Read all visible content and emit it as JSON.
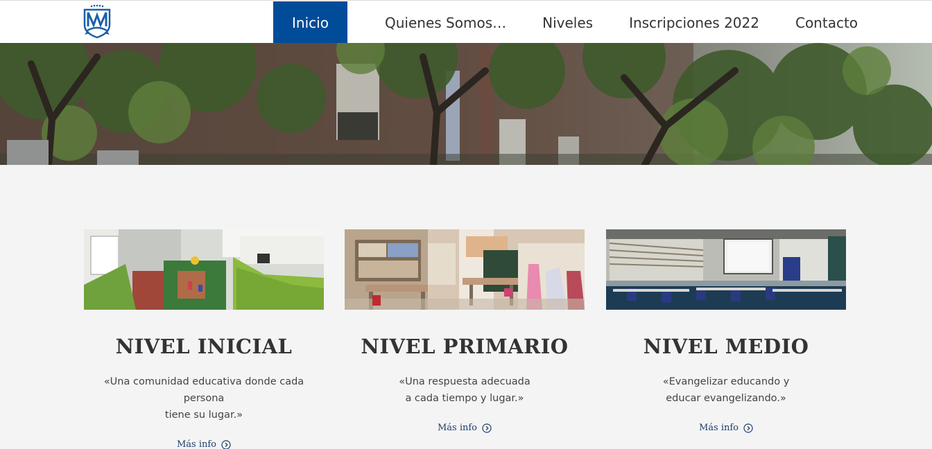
{
  "header": {
    "logo_icon": "school-crest-logo",
    "nav": [
      {
        "label": "Inicio",
        "active": true
      },
      {
        "label": "Quienes Somos…",
        "active": false
      },
      {
        "label": "Niveles",
        "active": false
      },
      {
        "label": "Inscripciones 2022",
        "active": false
      },
      {
        "label": "Contacto",
        "active": false
      }
    ]
  },
  "hero": {
    "image": "school-building-with-trees-photo"
  },
  "cards": [
    {
      "image": "playground-photo",
      "title": "NIVEL INICIAL",
      "description": "«Una comunidad educativa donde cada persona\ntiene su lugar.»",
      "link": "Más info",
      "link_icon": "circle-chevron-right-icon"
    },
    {
      "image": "primary-classroom-photo",
      "title": "NIVEL PRIMARIO",
      "description": "«Una respuesta adecuada\na cada tiempo y lugar.»",
      "link": "Más info",
      "link_icon": "circle-chevron-right-icon"
    },
    {
      "image": "secondary-classroom-photo",
      "title": "NIVEL MEDIO",
      "description": "«Evangelizar educando y\neducar evangelizando.»",
      "link": "Más info",
      "link_icon": "circle-chevron-right-icon"
    }
  ],
  "colors": {
    "brand_blue": "#004c99",
    "link_blue": "#1f3e6a",
    "page_bg": "#f4f4f4"
  }
}
